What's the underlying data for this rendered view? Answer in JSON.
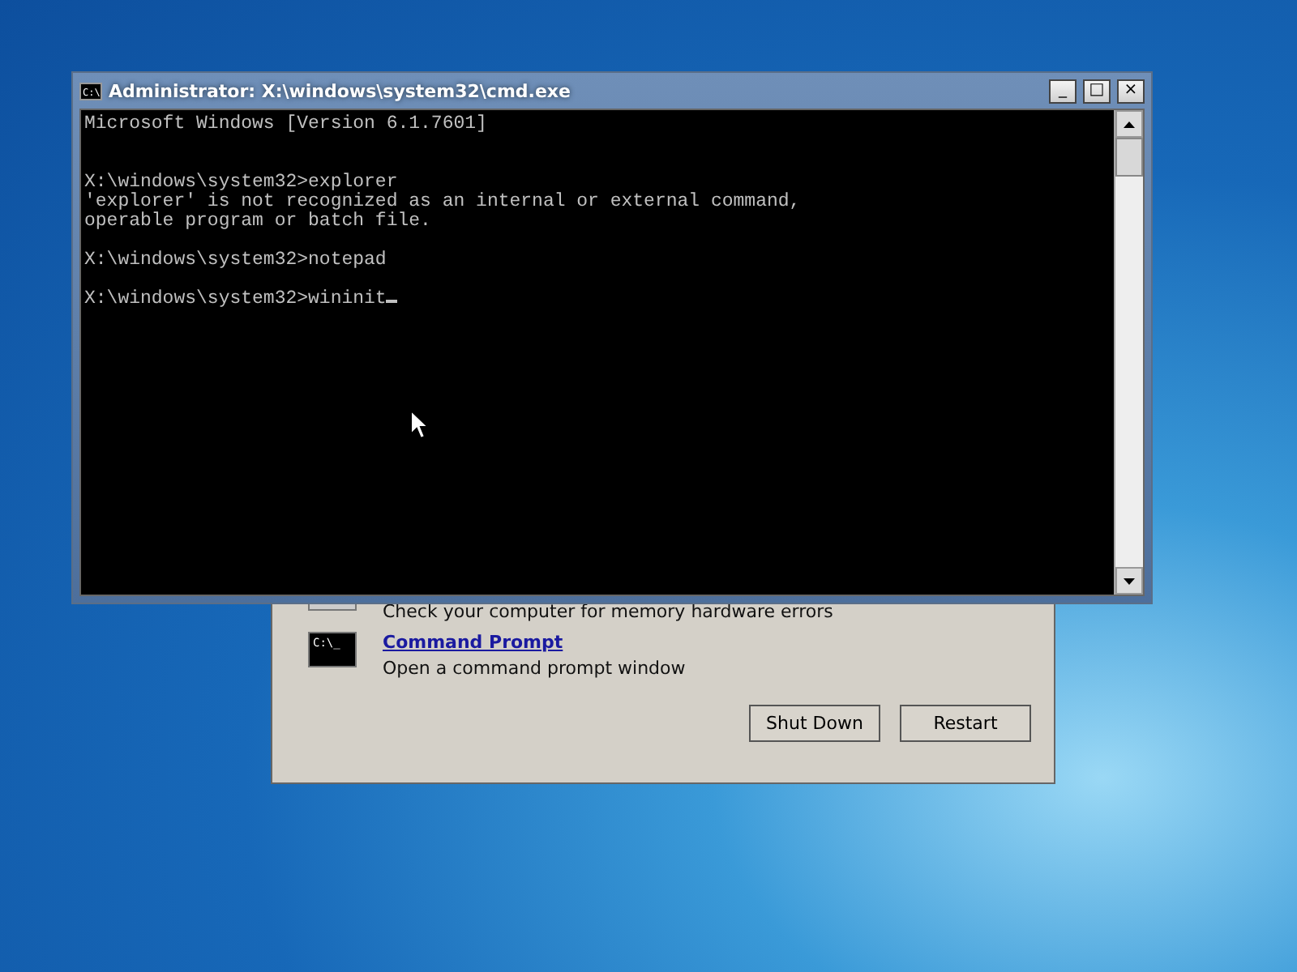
{
  "cmd_window": {
    "icon_text": "C:\\",
    "title": "Administrator: X:\\windows\\system32\\cmd.exe",
    "controls": [
      "_",
      "□",
      "×"
    ],
    "console_blocks": [
      {
        "kind": "banner",
        "lines": [
          "Microsoft Windows [Version 6.1.7601]"
        ]
      },
      {
        "kind": "output",
        "lines": [
          "X:\\windows\\system32>explorer",
          "'explorer' is not recognized as an internal or external command,",
          "operable program or batch file."
        ]
      },
      {
        "kind": "output",
        "lines": [
          "X:\\windows\\system32>notepad"
        ]
      },
      {
        "kind": "prompt",
        "lines": [
          "X:\\windows\\system32>wininit"
        ]
      }
    ]
  },
  "recovery_dialog": {
    "tools": [
      {
        "kind": "partial",
        "description": "Check your computer for memory hardware errors"
      },
      {
        "kind": "full",
        "icon_text": "C:\\_",
        "title": "Command Prompt",
        "description": "Open a command prompt window"
      }
    ],
    "buttons": [
      "Shut Down",
      "Restart"
    ]
  }
}
